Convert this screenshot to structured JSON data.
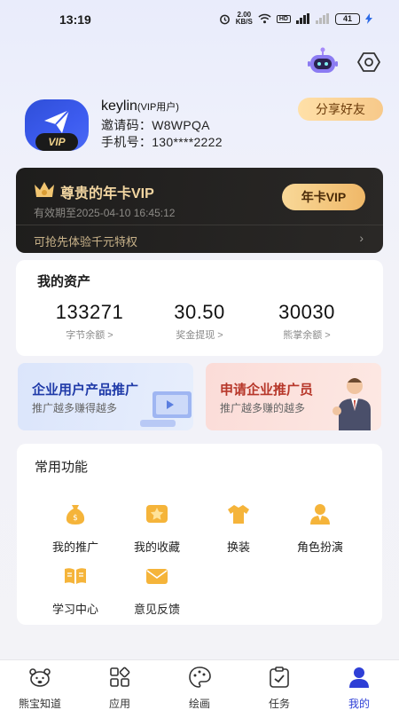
{
  "status_bar": {
    "time": "13:19",
    "net_speed_top": "2.00",
    "net_speed_bottom": "KB/S",
    "hd_label": "HD",
    "cell_label": "5G",
    "battery": "41"
  },
  "profile": {
    "name": "keylin",
    "role": "(VIP用户)",
    "invite_line": "邀请码：W8WPQA",
    "phone_line": "手机号：130****2222",
    "vip_badge": "VIP",
    "share_label": "分享好友"
  },
  "vip_card": {
    "title": "尊贵的年卡VIP",
    "expire": "有效期至2025-04-10 16:45:12",
    "button": "年卡VIP",
    "promo": "可抢先体验千元特权",
    "arrow": "›"
  },
  "assets": {
    "title": "我的资产",
    "items": [
      {
        "value": "133271",
        "label": "字节余额 >"
      },
      {
        "value": "30.50",
        "label": "奖金提现 >"
      },
      {
        "value": "30030",
        "label": "熊掌余额 >"
      }
    ]
  },
  "promos": [
    {
      "title": "企业用户产品推广",
      "subtitle": "推广越多赚得越多"
    },
    {
      "title": "申请企业推广员",
      "subtitle": "推广越多赚的越多"
    }
  ],
  "functions": {
    "title": "常用功能",
    "items": [
      {
        "label": "我的推广",
        "icon": "money-bag-icon"
      },
      {
        "label": "我的收藏",
        "icon": "star-icon"
      },
      {
        "label": "换装",
        "icon": "shirt-icon"
      },
      {
        "label": "角色扮演",
        "icon": "person-icon"
      },
      {
        "label": "学习中心",
        "icon": "book-icon"
      },
      {
        "label": "意见反馈",
        "icon": "envelope-icon"
      }
    ]
  },
  "tabs": [
    {
      "label": "熊宝知道",
      "icon": "bear-icon"
    },
    {
      "label": "应用",
      "icon": "apps-grid-icon"
    },
    {
      "label": "绘画",
      "icon": "palette-icon"
    },
    {
      "label": "任务",
      "icon": "clipboard-icon"
    },
    {
      "label": "我的",
      "icon": "user-icon",
      "active": true
    }
  ],
  "colors": {
    "accent": "#2e3fd6",
    "gold": "#f1d5a1",
    "icon_orange": "#f5b43a"
  }
}
